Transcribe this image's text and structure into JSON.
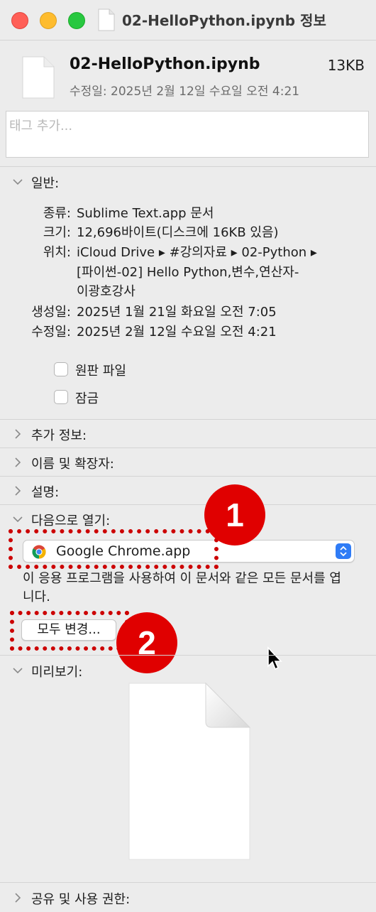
{
  "window": {
    "title": "02-HelloPython.ipynb 정보"
  },
  "header": {
    "file_name": "02-HelloPython.ipynb",
    "file_size": "13KB",
    "modified": "수정일: 2025년 2월 12일 수요일 오전 4:21"
  },
  "tags": {
    "placeholder": "태그 추가..."
  },
  "general": {
    "label": "일반:",
    "kind_key": "종류:",
    "kind_val": "Sublime Text.app 문서",
    "size_key": "크기:",
    "size_val": "12,696바이트(디스크에 16KB 있음)",
    "where_key": "위치:",
    "where_line1": "iCloud Drive ▸ #강의자료 ▸ 02-Python ▸",
    "where_line2": "[파이썬-02] Hello Python,변수,연산자-",
    "where_line3": "이광호강사",
    "created_key": "생성일:",
    "created_val": "2025년 1월 21일 화요일 오전 7:05",
    "modified_key": "수정일:",
    "modified_val": "2025년 2월 12일 수요일 오전 4:21",
    "stationery_label": "원판 파일",
    "locked_label": "잠금"
  },
  "sections": {
    "more_info": "추가 정보:",
    "name_ext": "이름 및 확장자:",
    "comments": "설명:",
    "open_with": "다음으로 열기:",
    "preview": "미리보기:",
    "sharing": "공유 및 사용 권한:"
  },
  "open_with": {
    "app_name": "Google Chrome.app",
    "description": "이 응용 프로그램을 사용하여 이 문서와 같은 모든 문서를 엽니다.",
    "change_all_label": "모두 변경..."
  },
  "annotations": {
    "badge1": "1",
    "badge2": "2"
  },
  "colors": {
    "annotation_red": "#e00000",
    "popup_blue": "#2f7cf6"
  },
  "icons": [
    "document-icon",
    "chevron-down-icon",
    "chevron-right-icon",
    "chrome-icon",
    "popup-arrows-icon",
    "mouse-cursor-icon"
  ]
}
